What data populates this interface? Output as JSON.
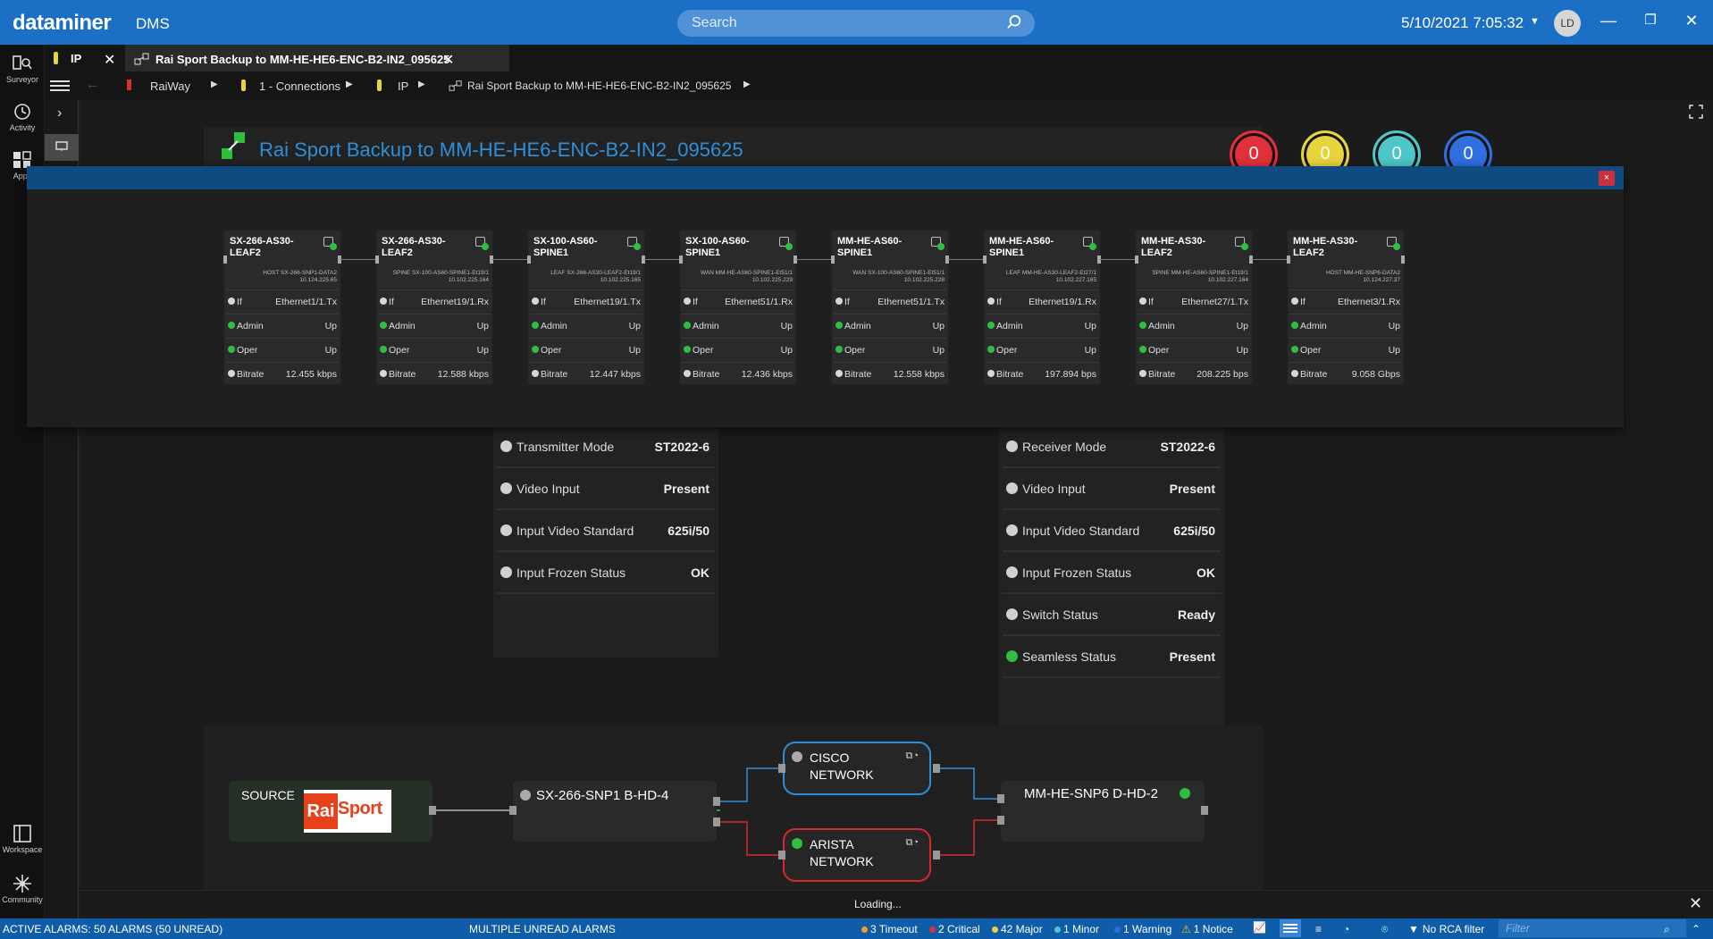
{
  "app": {
    "name": "dataminer",
    "product": "DMS"
  },
  "search": {
    "placeholder": "Search"
  },
  "clock": "5/10/2021 7:05:32",
  "user_initials": "LD",
  "colors": {
    "accent": "#1b6fc4",
    "green": "#2fbf3f",
    "critical": "#e0303a",
    "major": "#e8d43c",
    "minor": "#4fc6c8",
    "warning": "#2f6fe0",
    "cisco_link": "#2e8fd8",
    "arista_link": "#d8282e"
  },
  "leftnav": {
    "top": [
      {
        "label": "Surveyor",
        "icon": "surveyor-icon"
      },
      {
        "label": "Activity",
        "icon": "activity-icon"
      },
      {
        "label": "Apps",
        "icon": "apps-icon"
      }
    ],
    "bottom": [
      {
        "label": "Workspace",
        "icon": "workspace-icon"
      },
      {
        "label": "Community",
        "icon": "community-icon"
      }
    ]
  },
  "tabs": [
    {
      "label": "IP"
    },
    {
      "label": "Rai Sport Backup to MM-HE-HE6-ENC-B2-IN2_095625"
    }
  ],
  "breadcrumb": [
    "RaiWay",
    "1 - Connections",
    "IP",
    "Rai Sport Backup to MM-HE-HE6-ENC-B2-IN2_095625"
  ],
  "page_title": "Rai Sport Backup to MM-HE-HE6-ENC-B2-IN2_095625",
  "alarm_counters": [
    "0",
    "0",
    "0",
    "0"
  ],
  "transmitter_params": [
    {
      "label": "Transmitter Mode",
      "value": "ST2022-6",
      "state": "grey"
    },
    {
      "label": "Video Input",
      "value": "Present",
      "state": "grey"
    },
    {
      "label": "Input Video Standard",
      "value": "625i/50",
      "state": "grey"
    },
    {
      "label": "Input Frozen Status",
      "value": "OK",
      "state": "grey"
    }
  ],
  "receiver_params": [
    {
      "label": "Receiver Mode",
      "value": "ST2022-6",
      "state": "grey"
    },
    {
      "label": "Video Input",
      "value": "Present",
      "state": "grey"
    },
    {
      "label": "Input Video Standard",
      "value": "625i/50",
      "state": "grey"
    },
    {
      "label": "Input Frozen Status",
      "value": "OK",
      "state": "grey"
    },
    {
      "label": "Switch Status",
      "value": "Ready",
      "state": "grey"
    },
    {
      "label": "Seamless Status",
      "value": "Present",
      "state": "green"
    }
  ],
  "popup": {
    "close_label": "×",
    "hops": [
      {
        "name": "SX-266-AS30-LEAF2",
        "desc1": "HOST SX-266-SNP1-DATA2",
        "desc2": "10.124.225.65",
        "if": "Ethernet1/1.Tx",
        "admin": "Up",
        "oper": "Up",
        "bitrate": "12.455 kbps"
      },
      {
        "name": "SX-266-AS30-LEAF2",
        "desc1": "SPINE SX-100-AS60-SPINE1-Et19/1",
        "desc2": "10.102.225.164",
        "if": "Ethernet19/1.Rx",
        "admin": "Up",
        "oper": "Up",
        "bitrate": "12.588 kbps"
      },
      {
        "name": "SX-100-AS60-SPINE1",
        "desc1": "LEAF SX-266-AS30-LEAF2-Et19/1",
        "desc2": "10.102.225.165",
        "if": "Ethernet19/1.Tx",
        "admin": "Up",
        "oper": "Up",
        "bitrate": "12.447 kbps"
      },
      {
        "name": "SX-100-AS60-SPINE1",
        "desc1": "WAN MM-HE-AS60-SPINE1-Et51/1",
        "desc2": "10.102.225.229",
        "if": "Ethernet51/1.Rx",
        "admin": "Up",
        "oper": "Up",
        "bitrate": "12.436 kbps"
      },
      {
        "name": "MM-HE-AS60-SPINE1",
        "desc1": "WAN SX-100-AS60-SPINE1-Et51/1",
        "desc2": "10.102.225.228",
        "if": "Ethernet51/1.Tx",
        "admin": "Up",
        "oper": "Up",
        "bitrate": "12.558 kbps"
      },
      {
        "name": "MM-HE-AS60-SPINE1",
        "desc1": "LEAF MM-HE-AS30-LEAF2-Et27/1",
        "desc2": "10.102.227.165",
        "if": "Ethernet19/1.Rx",
        "admin": "Up",
        "oper": "Up",
        "bitrate": "197.894 bps"
      },
      {
        "name": "MM-HE-AS30-LEAF2",
        "desc1": "SPINE MM-HE-AS60-SPINE1-Et19/1",
        "desc2": "10.102.227.164",
        "if": "Ethernet27/1.Tx",
        "admin": "Up",
        "oper": "Up",
        "bitrate": "208.225 bps"
      },
      {
        "name": "MM-HE-AS30-LEAF2",
        "desc1": "HOST MM-HE-SNP6-DATA2",
        "desc2": "10.124.227.37",
        "if": "Ethernet3/1.Rx",
        "admin": "Up",
        "oper": "Up",
        "bitrate": "9.058 Gbps"
      }
    ],
    "row_labels": {
      "if": "If",
      "admin": "Admin",
      "oper": "Oper",
      "bitrate": "Bitrate"
    }
  },
  "diagram": {
    "source_label": "SOURCE",
    "source_logo": {
      "left": "Rai",
      "right": "Sport"
    },
    "encoder": "SX-266-SNP1 B-HD-4",
    "cisco": "CISCO NETWORK",
    "arista": "ARISTA NETWORK",
    "decoder": "MM-HE-SNP6 D-HD-2"
  },
  "loading": "Loading...",
  "status": {
    "active_alarms": "ACTIVE ALARMS: 50 ALARMS (50 UNREAD)",
    "multiple": "MULTIPLE UNREAD ALARMS",
    "timeout": "3 Timeout",
    "critical": "2 Critical",
    "major": "42 Major",
    "minor": "1 Minor",
    "warning": "1 Warning",
    "notice": "1 Notice",
    "rca": "No RCA filter",
    "filter_placeholder": "Filter"
  }
}
